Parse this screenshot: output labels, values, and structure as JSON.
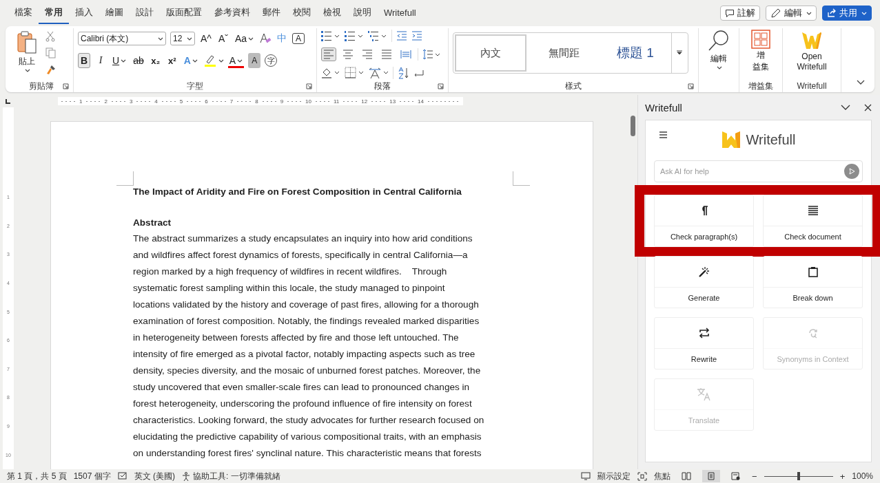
{
  "tabs": [
    {
      "label": "檔案",
      "selected": false
    },
    {
      "label": "常用",
      "selected": true
    },
    {
      "label": "插入",
      "selected": false
    },
    {
      "label": "繪圖",
      "selected": false
    },
    {
      "label": "設計",
      "selected": false
    },
    {
      "label": "版面配置",
      "selected": false
    },
    {
      "label": "參考資料",
      "selected": false
    },
    {
      "label": "郵件",
      "selected": false
    },
    {
      "label": "校閱",
      "selected": false
    },
    {
      "label": "檢視",
      "selected": false
    },
    {
      "label": "說明",
      "selected": false
    },
    {
      "label": "Writefull",
      "selected": false
    }
  ],
  "top_buttons": {
    "comments": "註解",
    "editing": "編輯",
    "share": "共用"
  },
  "clipboard": {
    "paste": "貼上",
    "label": "剪貼簿"
  },
  "font": {
    "name": "Calibri (本文)",
    "size": "12",
    "label": "字型",
    "row1": [
      {
        "label": "A^",
        "kind": "grow",
        "pressed": false
      },
      {
        "label": "Aˇ",
        "kind": "shrink",
        "pressed": false
      },
      {
        "label": "Aa",
        "kind": "case",
        "pressed": false
      },
      {
        "label": "中",
        "kind": "phonetic",
        "pressed": false
      },
      {
        "label": "A",
        "kind": "boxed",
        "pressed": false
      }
    ],
    "row2": [
      {
        "label": "B",
        "kind": "bold",
        "pressed": true
      },
      {
        "label": "I",
        "kind": "italic",
        "pressed": false
      },
      {
        "label": "U",
        "kind": "underline",
        "pressed": false
      },
      {
        "label": "ab",
        "kind": "strike",
        "pressed": false
      },
      {
        "label": "x₂",
        "kind": "sub",
        "pressed": false
      },
      {
        "label": "x²",
        "kind": "sup",
        "pressed": false
      },
      {
        "label": "A",
        "kind": "effect",
        "pressed": false
      },
      {
        "label": "A",
        "kind": "color",
        "pressed": false
      },
      {
        "label": "A",
        "kind": "shaded",
        "pressed": false
      },
      {
        "label": "字",
        "kind": "enclosed",
        "pressed": false
      }
    ]
  },
  "paragraph": {
    "label": "段落",
    "align": [
      {
        "selected": true
      },
      {
        "selected": false
      },
      {
        "selected": false
      },
      {
        "selected": false
      },
      {
        "selected": false
      }
    ]
  },
  "styles": {
    "label": "樣式",
    "items": [
      {
        "label": "內文",
        "kind": "normal",
        "selected": true
      },
      {
        "label": "無間距",
        "kind": "normal",
        "selected": false
      },
      {
        "label": "標題 1",
        "kind": "heading",
        "selected": false
      }
    ]
  },
  "editing": {
    "label": "編輯"
  },
  "addins": {
    "button_lines": [
      "增",
      "益集"
    ],
    "label": "增益集"
  },
  "writefull_group": {
    "button": "Open\nWritefull",
    "label": "Writefull"
  },
  "ruler": {
    "numbers": [
      "1",
      "2",
      "3",
      "4",
      "5",
      "6",
      "7",
      "8",
      "9",
      "10",
      "11",
      "12",
      "13",
      "14"
    ],
    "vertical": [
      "1",
      "2",
      "3",
      "4",
      "5",
      "6",
      "7",
      "8",
      "9",
      "10"
    ]
  },
  "document": {
    "title": "The Impact of Aridity and Fire on Forest Composition in Central California",
    "heading": "Abstract",
    "lines": [
      "The abstract summarizes a study encapsulates an inquiry into how arid conditions",
      "and wildfires affect forest dynamics of forests, specifically in central California—a",
      "region marked by a high frequency of wildfires in recent wildfires.    Through",
      "systematic forest sampling within this locale, the study managed to pinpoint",
      "locations validated by the history and coverage of past fires, allowing for a thorough",
      "examination of forest composition. Notably, the findings revealed marked disparities",
      "in heterogeneity between forests affected by fire and those left untouched. The",
      "intensity of fire emerged as a pivotal factor, notably impacting aspects such as tree",
      "density, species diversity, and the mosaic of unburned forest patches. Moreover, the",
      "study uncovered that even smaller-scale fires can lead to pronounced changes in",
      "forest heterogeneity, underscoring the profound influence of fire intensity on forest",
      "characteristics. Looking forward, the study advocates for further research focused on",
      "elucidating the predictive capability of various compositional traits, with an emphasis",
      "on understanding forest fires' synclinal nature. This characteristic means that forests"
    ]
  },
  "panel": {
    "title": "Writefull",
    "brand": "Writefull",
    "placeholder": "Ask AI for help",
    "tool_rows": [
      {
        "highlighted": true,
        "tools": [
          {
            "label": "Check paragraph(s)",
            "kind": "paragraph",
            "disabled": false
          },
          {
            "label": "Check document",
            "kind": "document",
            "disabled": false
          }
        ]
      },
      {
        "highlighted": false,
        "tools": [
          {
            "label": "Generate",
            "kind": "generate",
            "disabled": false
          },
          {
            "label": "Break down",
            "kind": "breakdown",
            "disabled": false
          }
        ]
      },
      {
        "highlighted": false,
        "tools": [
          {
            "label": "Rewrite",
            "kind": "rewrite",
            "disabled": false
          },
          {
            "label": "Synonyms in Context",
            "kind": "synonyms",
            "disabled": true
          }
        ]
      },
      {
        "highlighted": false,
        "tools": [
          {
            "label": "Translate",
            "kind": "translate",
            "disabled": true
          }
        ]
      }
    ]
  },
  "status_bar": {
    "page": "第 1 頁，共 5 頁",
    "words": "1507 個字",
    "language": "英文 (美國)",
    "accessibility": "協助工具: 一切準備就緒",
    "display": "顯示設定",
    "focus": "焦點",
    "views": [
      {
        "selected": false
      },
      {
        "selected": true
      },
      {
        "selected": false
      }
    ],
    "zoom_out": "−",
    "zoom_in": "+",
    "zoom": {
      "level": 0.5
    },
    "zoom_text": "100%"
  }
}
